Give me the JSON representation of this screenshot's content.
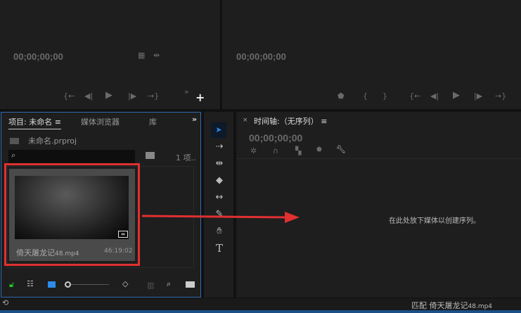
{
  "source_monitor": {
    "timecode": "00;00;00;00"
  },
  "program_monitor": {
    "timecode": "00;00;00;00"
  },
  "project": {
    "tabs": [
      {
        "label": "项目: 未命名"
      },
      {
        "label": "媒体浏览器"
      },
      {
        "label": "库"
      }
    ],
    "file": "未命名.prproj",
    "search_placeholder": "",
    "count": "1 项..",
    "clip": {
      "name": "倚天屠龙记",
      "ext": "48.mp4",
      "duration": "46:19:02"
    }
  },
  "timeline": {
    "title": "时间轴:（无序列）",
    "timecode": "00;00;00;00",
    "drop_hint": "在此处放下媒体以创建序列。"
  },
  "status": {
    "match_label": "匹配",
    "match_name": "倚天屠龙记",
    "match_ext": "48.mp4"
  },
  "colors": {
    "accent": "#2d8ceb",
    "highlight": "#e03030",
    "panel_border": "#2f6fb0"
  }
}
